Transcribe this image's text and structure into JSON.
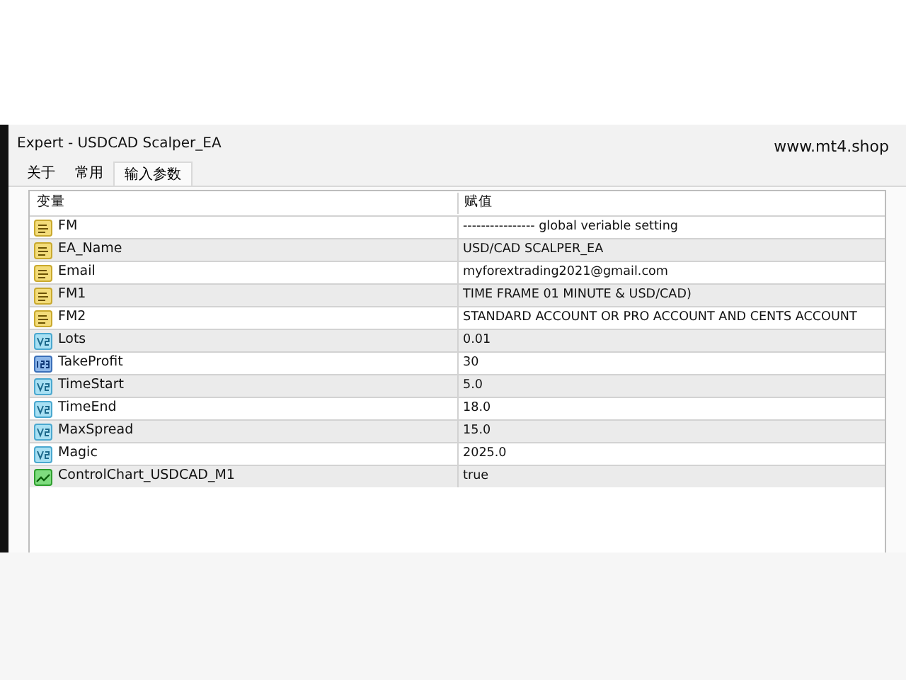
{
  "window": {
    "title": "Expert - USDCAD Scalper_EA",
    "watermark_text": "www.mt4.shop"
  },
  "tabs": [
    {
      "label": "关于",
      "selected": false
    },
    {
      "label": "常用",
      "selected": false
    },
    {
      "label": "输入参数",
      "selected": true
    }
  ],
  "table": {
    "columns": [
      "变量",
      "赋值"
    ],
    "rows": [
      {
        "kind": "string",
        "name": "FM",
        "value": "---------------- global veriable setting"
      },
      {
        "kind": "string",
        "name": "EA_Name",
        "value": "USD/CAD SCALPER_EA"
      },
      {
        "kind": "string",
        "name": "Email",
        "value": "myforextrading2021@gmail.com"
      },
      {
        "kind": "string",
        "name": "FM1",
        "value": "TIME FRAME 01 MINUTE & USD/CAD)"
      },
      {
        "kind": "string",
        "name": "FM2",
        "value": "STANDARD ACCOUNT OR PRO ACCOUNT AND CENTS ACCOUNT"
      },
      {
        "kind": "double",
        "name": "Lots",
        "value": "0.01"
      },
      {
        "kind": "int",
        "name": "TakeProfit",
        "value": "30"
      },
      {
        "kind": "double",
        "name": "TimeStart",
        "value": "5.0"
      },
      {
        "kind": "double",
        "name": "TimeEnd",
        "value": "18.0"
      },
      {
        "kind": "double",
        "name": "MaxSpread",
        "value": "15.0"
      },
      {
        "kind": "double",
        "name": "Magic",
        "value": "2025.0"
      },
      {
        "kind": "bool",
        "name": "ControlChart_USDCAD_M1",
        "value": "true"
      }
    ]
  }
}
